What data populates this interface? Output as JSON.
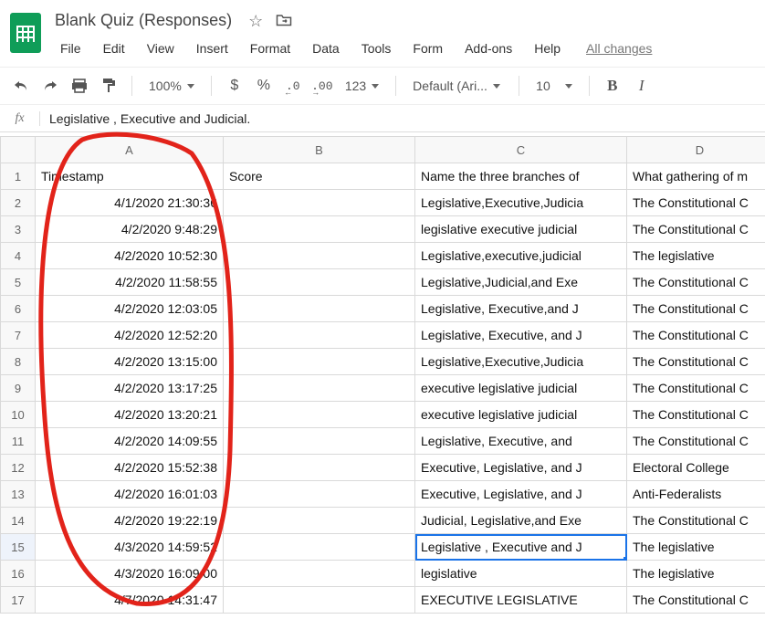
{
  "doc": {
    "title": "Blank Quiz (Responses)",
    "all_changes": "All changes"
  },
  "menus": [
    "File",
    "Edit",
    "View",
    "Insert",
    "Format",
    "Data",
    "Tools",
    "Form",
    "Add-ons",
    "Help"
  ],
  "toolbar": {
    "zoom": "100%",
    "currency": "$",
    "percent": "%",
    "dec_dec": ".0",
    "dec_inc": ".00",
    "numfmt": "123",
    "font": "Default (Ari...",
    "font_size": "10",
    "bold": "B",
    "italic": "I"
  },
  "formula_bar": {
    "fx": "fx",
    "value": "Legislative , Executive and Judicial."
  },
  "columns": [
    "A",
    "B",
    "C",
    "D"
  ],
  "headers": {
    "A": "Timestamp",
    "B": "Score",
    "C": "Name the three branches of",
    "D": "What gathering of m"
  },
  "rows": [
    {
      "n": 2,
      "ts": "4/1/2020 21:30:36",
      "score": "",
      "c": "Legislative,Executive,Judicia",
      "d": "The Constitutional C"
    },
    {
      "n": 3,
      "ts": "4/2/2020 9:48:29",
      "score": "",
      "c": "legislative executive judicial",
      "d": "The Constitutional C"
    },
    {
      "n": 4,
      "ts": "4/2/2020 10:52:30",
      "score": "",
      "c": "Legislative,executive,judicial",
      "d": "The legislative"
    },
    {
      "n": 5,
      "ts": "4/2/2020 11:58:55",
      "score": "",
      "c": "Legislative,Judicial,and Exe",
      "d": "The Constitutional C"
    },
    {
      "n": 6,
      "ts": "4/2/2020 12:03:05",
      "score": "",
      "c": "Legislative, Executive,and  J",
      "d": "The Constitutional C"
    },
    {
      "n": 7,
      "ts": "4/2/2020 12:52:20",
      "score": "",
      "c": "Legislative, Executive, and J",
      "d": "The Constitutional C"
    },
    {
      "n": 8,
      "ts": "4/2/2020 13:15:00",
      "score": "",
      "c": "Legislative,Executive,Judicia",
      "d": "The Constitutional C"
    },
    {
      "n": 9,
      "ts": "4/2/2020 13:17:25",
      "score": "",
      "c": "executive legislative judicial",
      "d": "The Constitutional C"
    },
    {
      "n": 10,
      "ts": "4/2/2020 13:20:21",
      "score": "",
      "c": "executive legislative judicial",
      "d": "The Constitutional C"
    },
    {
      "n": 11,
      "ts": "4/2/2020 14:09:55",
      "score": "",
      "c": "Legislative, Executive,  and ",
      "d": "The Constitutional C"
    },
    {
      "n": 12,
      "ts": "4/2/2020 15:52:38",
      "score": "",
      "c": "Executive, Legislative, and J",
      "d": "Electoral College"
    },
    {
      "n": 13,
      "ts": "4/2/2020 16:01:03",
      "score": "",
      "c": "Executive, Legislative, and J",
      "d": "Anti-Federalists"
    },
    {
      "n": 14,
      "ts": "4/2/2020 19:22:19",
      "score": "",
      "c": "Judicial, Legislative,and Exe",
      "d": "The Constitutional C"
    },
    {
      "n": 15,
      "ts": "4/3/2020 14:59:52",
      "score": "",
      "c": "Legislative , Executive and J",
      "d": "The legislative",
      "selected": true
    },
    {
      "n": 16,
      "ts": "4/3/2020 16:09:00",
      "score": "",
      "c": "legislative",
      "d": "The legislative"
    },
    {
      "n": 17,
      "ts": "4/7/2020 14:31:47",
      "score": "",
      "c": "EXECUTIVE LEGISLATIVE",
      "d": "The Constitutional C"
    }
  ]
}
